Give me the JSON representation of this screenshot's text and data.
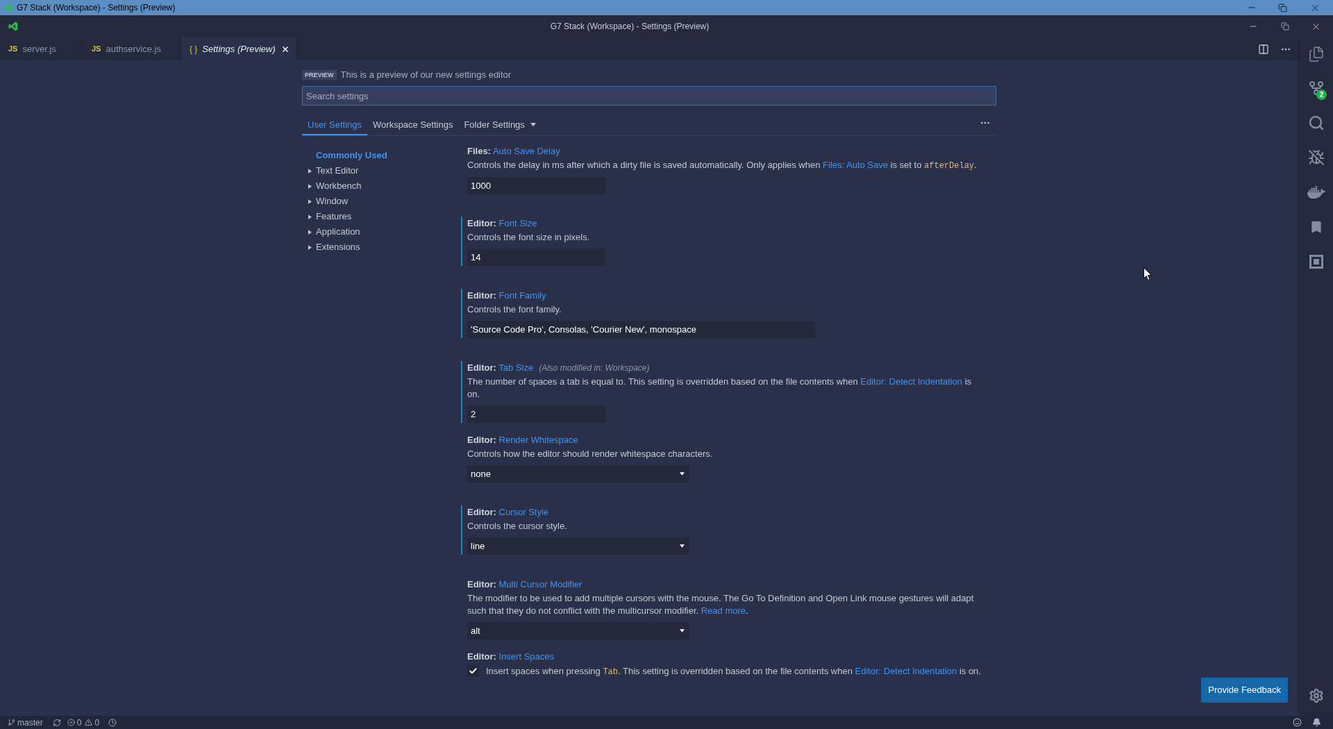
{
  "os_window": {
    "title": "G7 Stack (Workspace) - Settings (Preview)"
  },
  "title_bar": {
    "title": "G7 Stack (Workspace) - Settings (Preview)"
  },
  "editor_tabs": [
    {
      "kind": "js",
      "icon": "JS",
      "label": "server.js",
      "selected": false,
      "preview": false
    },
    {
      "kind": "js",
      "icon": "JS",
      "label": "authservice.js",
      "selected": false,
      "preview": false
    },
    {
      "kind": "json",
      "icon": "{ }",
      "label": "Settings (Preview)",
      "selected": true,
      "preview": true
    }
  ],
  "settings_editor": {
    "preview_badge": "PREVIEW",
    "preview_text": "This is a preview of our new settings editor",
    "search": {
      "placeholder": "Search settings"
    },
    "scope_tabs": [
      {
        "kind": "tab",
        "label": "User Settings",
        "selected": true
      },
      {
        "kind": "tab",
        "label": "Workspace Settings",
        "selected": false
      },
      {
        "kind": "dropdown",
        "label": "Folder Settings",
        "selected": false
      }
    ],
    "toc": [
      {
        "kind": "leaf",
        "label": "Commonly Used",
        "selected": true
      },
      {
        "kind": "group",
        "label": "Text Editor",
        "selected": false
      },
      {
        "kind": "group",
        "label": "Workbench",
        "selected": false
      },
      {
        "kind": "group",
        "label": "Window",
        "selected": false
      },
      {
        "kind": "group",
        "label": "Features",
        "selected": false
      },
      {
        "kind": "group",
        "label": "Application",
        "selected": false
      },
      {
        "kind": "group",
        "label": "Extensions",
        "selected": false
      }
    ],
    "settings": [
      {
        "category": "Files:",
        "name": "Auto Save Delay",
        "modified": false,
        "description": [
          {
            "kind": "text",
            "text": "Controls the delay in ms after which a dirty file is saved automatically. Only applies when "
          },
          {
            "kind": "link",
            "text": "Files: Auto Save"
          },
          {
            "kind": "text",
            "text": " is set to "
          },
          {
            "kind": "code",
            "text": "afterDelay"
          },
          {
            "kind": "text",
            "text": "."
          }
        ],
        "control": {
          "kind": "number",
          "value": "1000"
        }
      },
      {
        "category": "Editor:",
        "name": "Font Size",
        "modified": true,
        "description": [
          {
            "kind": "text",
            "text": "Controls the font size in pixels."
          }
        ],
        "control": {
          "kind": "number",
          "value": "14"
        }
      },
      {
        "category": "Editor:",
        "name": "Font Family",
        "modified": true,
        "description": [
          {
            "kind": "text",
            "text": "Controls the font family."
          }
        ],
        "control": {
          "kind": "string",
          "value": "'Source Code Pro', Consolas, 'Courier New', monospace"
        }
      },
      {
        "category": "Editor:",
        "name": "Tab Size",
        "note": "(Also modified in: Workspace)",
        "modified": true,
        "description": [
          {
            "kind": "text",
            "text": "The number of spaces a tab is equal to. This setting is overridden based on the file contents when "
          },
          {
            "kind": "link",
            "text": "Editor: Detect Indentation"
          },
          {
            "kind": "text",
            "text": " is on."
          }
        ],
        "control": {
          "kind": "number",
          "value": "2"
        }
      },
      {
        "category": "Editor:",
        "name": "Render Whitespace",
        "modified": false,
        "description": [
          {
            "kind": "text",
            "text": "Controls how the editor should render whitespace characters."
          }
        ],
        "control": {
          "kind": "enum",
          "value": "none"
        }
      },
      {
        "category": "Editor:",
        "name": "Cursor Style",
        "modified": true,
        "description": [
          {
            "kind": "text",
            "text": "Controls the cursor style."
          }
        ],
        "control": {
          "kind": "enum",
          "value": "line"
        }
      },
      {
        "category": "Editor:",
        "name": "Multi Cursor Modifier",
        "modified": false,
        "description": [
          {
            "kind": "text",
            "text": "The modifier to be used to add multiple cursors with the mouse. The Go To Definition and Open Link mouse gestures will adapt such that they do not conflict with the multicursor modifier. "
          },
          {
            "kind": "link",
            "text": "Read more"
          },
          {
            "kind": "text",
            "text": "."
          }
        ],
        "control": {
          "kind": "enum",
          "value": "alt"
        }
      },
      {
        "category": "Editor:",
        "name": "Insert Spaces",
        "modified": false,
        "description": [
          {
            "kind": "text",
            "text": "Insert spaces when pressing "
          },
          {
            "kind": "code",
            "text": "Tab"
          },
          {
            "kind": "text",
            "text": ". This setting is overridden based on the file contents when "
          },
          {
            "kind": "link",
            "text": "Editor: Detect Indentation"
          },
          {
            "kind": "text",
            "text": " is on."
          }
        ],
        "control": {
          "kind": "checkbox",
          "checked": true
        }
      }
    ],
    "feedback_button": "Provide Feedback"
  },
  "activity_bar": {
    "source_control_badge": "2"
  },
  "status_bar": {
    "branch": "master",
    "errors": "0",
    "warnings": "0"
  }
}
